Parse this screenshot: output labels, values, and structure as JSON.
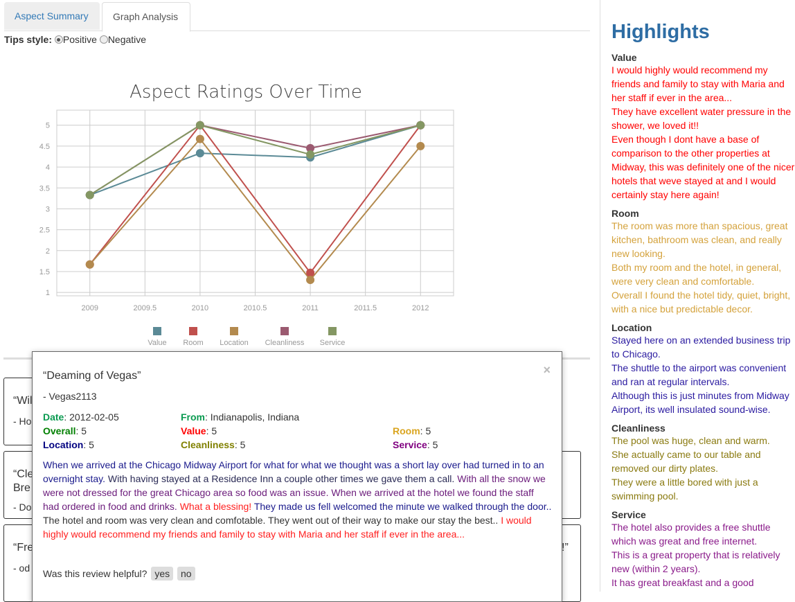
{
  "tabs": [
    {
      "label": "Aspect Summary",
      "active": false
    },
    {
      "label": "Graph Analysis",
      "active": true
    }
  ],
  "tips": {
    "label": "Tips style:",
    "options": [
      {
        "label": "Positive",
        "checked": true
      },
      {
        "label": "Negative",
        "checked": false
      }
    ]
  },
  "chart_data": {
    "type": "line",
    "title": "Aspect Ratings Over Time",
    "x": [
      2009,
      2010,
      2011,
      2012
    ],
    "xlim": [
      2008.7,
      2012.3
    ],
    "ylim": [
      0.92,
      5.36
    ],
    "xticks": [
      "2009",
      "2009.5",
      "2010",
      "2010.5",
      "2011",
      "2011.5",
      "2012"
    ],
    "yticks": [
      "1",
      "1.5",
      "2",
      "2.5",
      "3",
      "3.5",
      "4",
      "4.5",
      "5"
    ],
    "grid": true,
    "legend": "bottom",
    "series": [
      {
        "name": "Value",
        "color": "#5b8a96",
        "values": [
          3.33,
          4.33,
          4.23,
          5
        ]
      },
      {
        "name": "Room",
        "color": "#c0504d",
        "values": [
          1.67,
          5,
          1.47,
          5
        ]
      },
      {
        "name": "Location",
        "color": "#b38a4e",
        "values": [
          1.67,
          4.67,
          1.3,
          4.5
        ]
      },
      {
        "name": "Cleanliness",
        "color": "#9b5a70",
        "values": [
          3.33,
          5,
          4.45,
          5
        ]
      },
      {
        "name": "Service",
        "color": "#849763",
        "values": [
          3.33,
          5,
          4.3,
          5
        ]
      }
    ]
  },
  "background_cards": [
    {
      "quote": "“Wil",
      "user": "- Ho"
    },
    {
      "quote": "“Cle",
      "quote2": "Bre",
      "user": "- Do"
    },
    {
      "quote": "“Fre",
      "user": "- od",
      "tail": "!”"
    }
  ],
  "modal": {
    "close": "×",
    "title": "“Deaming of Vegas”",
    "user": "- Vegas2113",
    "date_label": "Date",
    "date": ": 2012-02-05",
    "from_label": "From",
    "from": ": Indianapolis, Indiana",
    "ratings": [
      {
        "label": "Overall",
        "value": ": 5",
        "color": "#008000"
      },
      {
        "label": "Value",
        "value": ": 5",
        "color": "#ff0000"
      },
      {
        "label": "Room",
        "value": ": 5",
        "color": "#daa520"
      },
      {
        "label": "Location",
        "value": ": 5",
        "color": "#000080"
      },
      {
        "label": "Cleanliness",
        "value": ": 5",
        "color": "#808000"
      },
      {
        "label": "Service",
        "value": ": 5",
        "color": "#800080"
      }
    ],
    "body": [
      {
        "text": "When we arrived at the Chicago Midway Airport for what for what we thought was a short lay over had turned in to an overnight stay. ",
        "color": "#1a1a8c"
      },
      {
        "text": "With having stayed at a Residence Inn a couple other times we gave them a call. ",
        "color": "#2a2a55"
      },
      {
        "text": "With all the snow we were not dressed for the great Chicago area so food was an issue. When we arrived at the hotel we found the staff had ordered in food and drinks. ",
        "color": "#6a1a7a"
      },
      {
        "text": "What a blessing! ",
        "color": "#ff2020"
      },
      {
        "text": "They made us fell welcomed the minute we walked through the door.. ",
        "color": "#1a1a8c"
      },
      {
        "text": "The hotel and room was very clean and comfotable. They went out of their way to make our stay the best.. ",
        "color": "#333333"
      },
      {
        "text": "I would highly would recommend my friends and family to stay with Maria and her staff if ever in the area...",
        "color": "#ff2020"
      }
    ],
    "helpful": "Was this review helpful?",
    "yes": "yes",
    "no": "no"
  },
  "highlights": {
    "title": "Highlights",
    "sections": [
      {
        "name": "Value",
        "color": "#ff0000",
        "items": [
          "I would highly would recommend my friends and family to stay with Maria and her staff if ever in the area...",
          "They have excellent water pressure in the shower, we loved it!!",
          "Even though I dont have a base of comparison to the other properties at Midway, this was definitely one of the nicer hotels that weve stayed at and I would certainly stay here again!"
        ]
      },
      {
        "name": "Room",
        "color": "#d4a23c",
        "items": [
          "The room was more than spacious, great kitchen, bathroom was clean, and really new looking.",
          "Both my room and the hotel, in general, were very clean and comfortable.",
          "Overall I found the hotel tidy, quiet, bright, with a nice but predictable decor."
        ]
      },
      {
        "name": "Location",
        "color": "#2a1aa0",
        "items": [
          "Stayed here on an extended business trip to Chicago.",
          "The shuttle to the airport was convenient and ran at regular intervals.",
          "Although this is just minutes from Midway Airport, its well insulated sound-wise."
        ]
      },
      {
        "name": "Cleanliness",
        "color": "#8a7a10",
        "items": [
          "The pool was huge, clean and warm.",
          "She actually came to our table and removed our dirty plates.",
          "They were a little bored with just a swimming pool."
        ]
      },
      {
        "name": "Service",
        "color": "#8a1a8a",
        "items": [
          "The hotel also provides a free shuttle which was great and free internet.",
          "This is a great property that is relatively new (within 2 years).",
          "It has great breakfast and a good"
        ]
      }
    ]
  }
}
